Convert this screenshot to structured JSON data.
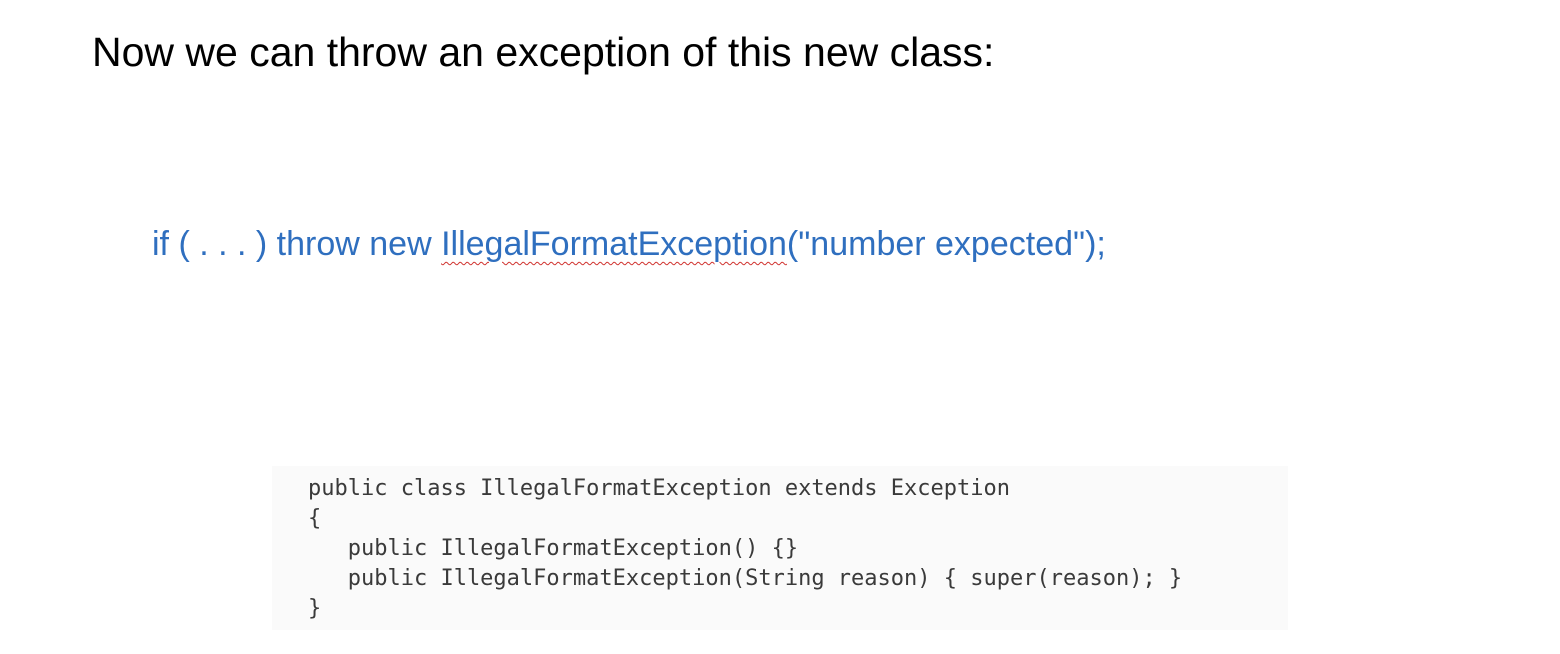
{
  "title": "Now we can throw an exception of this new class:",
  "statement": {
    "prefix": "if ( . . . ) throw new ",
    "class_name": "IllegalFormatException",
    "suffix": "(\"number expected\");",
    "text_color": "#2f6fbf",
    "spellcheck_color": "#d0312d"
  },
  "code_block": {
    "lines": [
      "public class IllegalFormatException extends Exception",
      "{",
      "   public IllegalFormatException() {}",
      "   public IllegalFormatException(String reason) { super(reason); }",
      "}"
    ]
  }
}
